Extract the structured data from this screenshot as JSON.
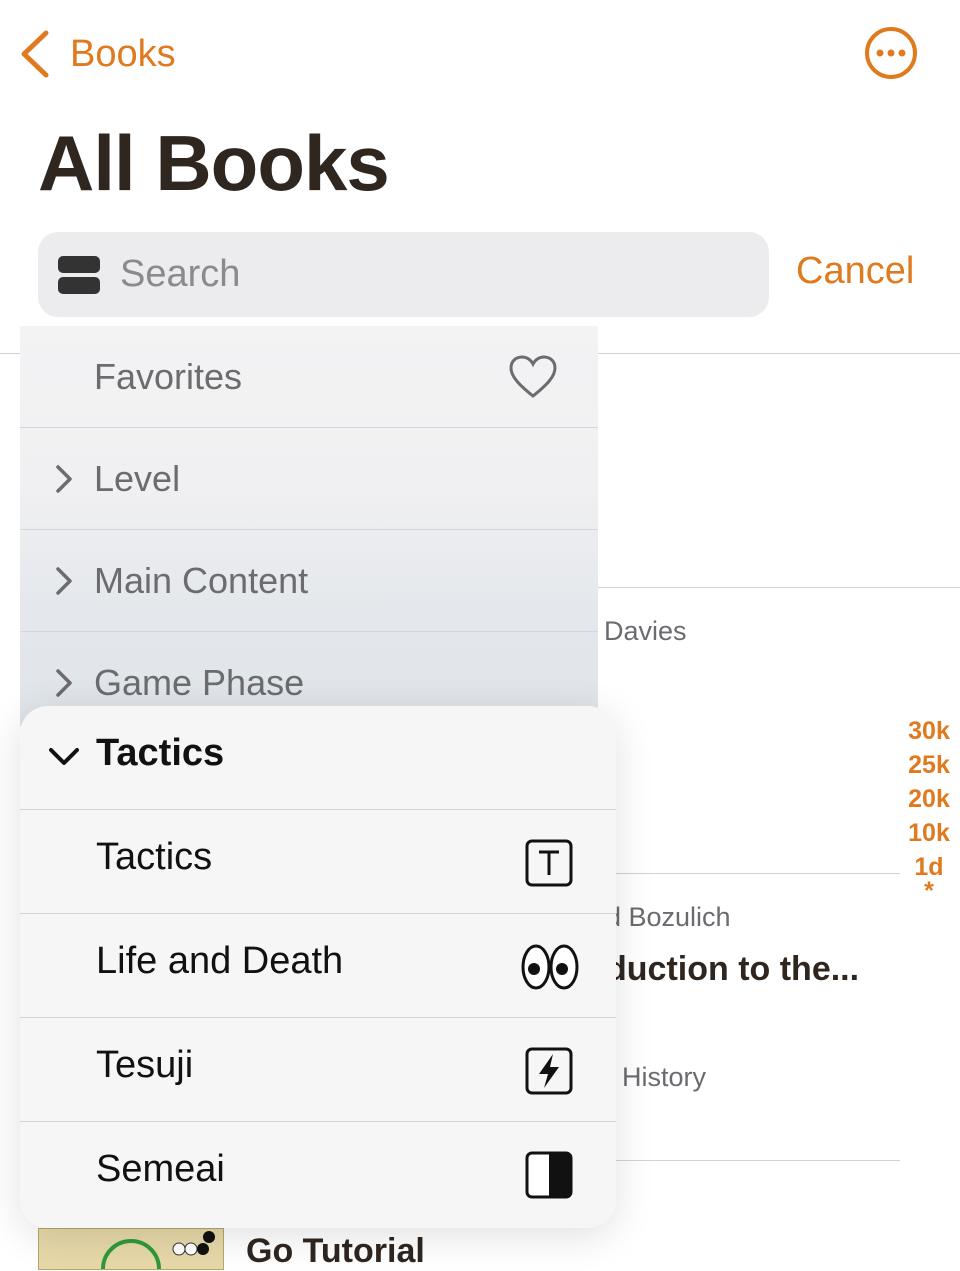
{
  "nav": {
    "back_label": "Books"
  },
  "page": {
    "title": "All Books"
  },
  "search": {
    "placeholder": "Search",
    "cancel_label": "Cancel"
  },
  "background": {
    "author_1": "Davies",
    "author_2": "d Bozulich",
    "title_2": "duction to the...",
    "category_2": "History",
    "title_3": "Go Tutorial",
    "levels": [
      "30k",
      "25k",
      "20k",
      "10k",
      "1d",
      "*"
    ]
  },
  "menu": {
    "items": [
      {
        "label": "Favorites",
        "icon": "heart-icon"
      },
      {
        "label": "Level",
        "icon": "chevron-right-icon"
      },
      {
        "label": "Main Content",
        "icon": "chevron-right-icon"
      },
      {
        "label": "Game Phase",
        "icon": "chevron-right-icon"
      }
    ],
    "submenu": {
      "title": "Tactics",
      "items": [
        {
          "label": "Tactics",
          "icon": "letter-t-square-icon"
        },
        {
          "label": "Life and Death",
          "icon": "eyes-icon"
        },
        {
          "label": "Tesuji",
          "icon": "bolt-square-icon"
        },
        {
          "label": "Semeai",
          "icon": "half-filled-square-icon"
        }
      ]
    }
  },
  "colors": {
    "accent": "#e07a1f",
    "title": "#2f2620"
  }
}
